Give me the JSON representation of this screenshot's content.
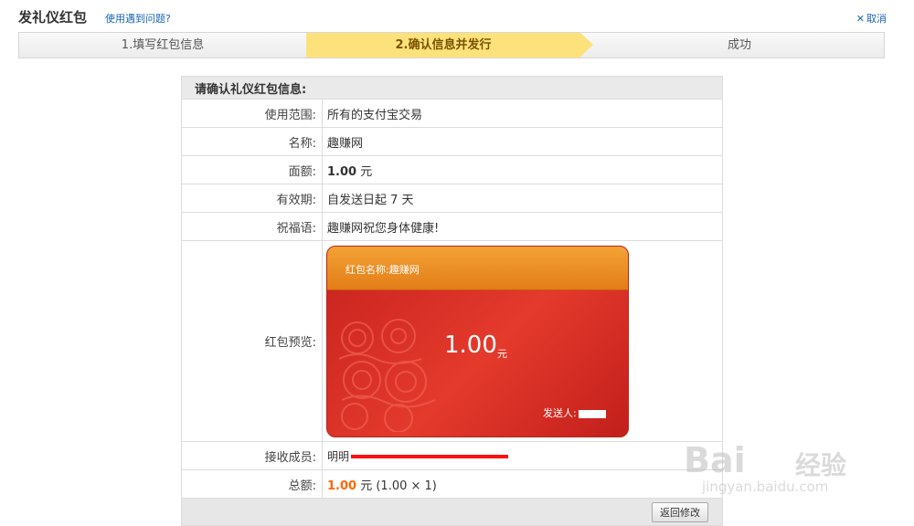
{
  "header": {
    "title": "发礼仪红包",
    "help_link": "使用遇到问题?",
    "cancel": "取消"
  },
  "steps": [
    {
      "label": "1.填写红包信息",
      "active": false
    },
    {
      "label": "2.确认信息并发行",
      "active": true
    },
    {
      "label": "成功",
      "active": false
    }
  ],
  "confirm": {
    "title": "请确认礼仪红包信息:",
    "rows": {
      "scope": {
        "label": "使用范围:",
        "value": "所有的支付宝交易"
      },
      "name": {
        "label": "名称:",
        "value": "趣赚网"
      },
      "amount": {
        "label": "面额:",
        "value": "1.00",
        "unit": "元"
      },
      "validity": {
        "label": "有效期:",
        "value": "自发送日起 7 天"
      },
      "greeting": {
        "label": "祝福语:",
        "value": "趣赚网祝您身体健康!"
      },
      "preview": {
        "label": "红包预览:"
      },
      "receiver": {
        "label": "接收成员:",
        "value_partial": "明明"
      },
      "total": {
        "label": "总额:",
        "amount": "1.00",
        "rest": "元 (1.00 × 1)"
      }
    },
    "back_button": "返回修改"
  },
  "card": {
    "name_label": "红包名称:",
    "name_value": "趣赚网",
    "amount": "1.00",
    "unit": "元",
    "sender_label": "发送人:",
    "colors": {
      "head": "#e8861c",
      "body": "#d42a24"
    }
  },
  "watermark": {
    "brand": "Bai",
    "brand_cn": "经验",
    "url": "jingyan.baidu.com"
  },
  "colors": {
    "link": "#1a66b3",
    "active_step": "#fde27b",
    "amount_highlight": "#ff6600"
  }
}
